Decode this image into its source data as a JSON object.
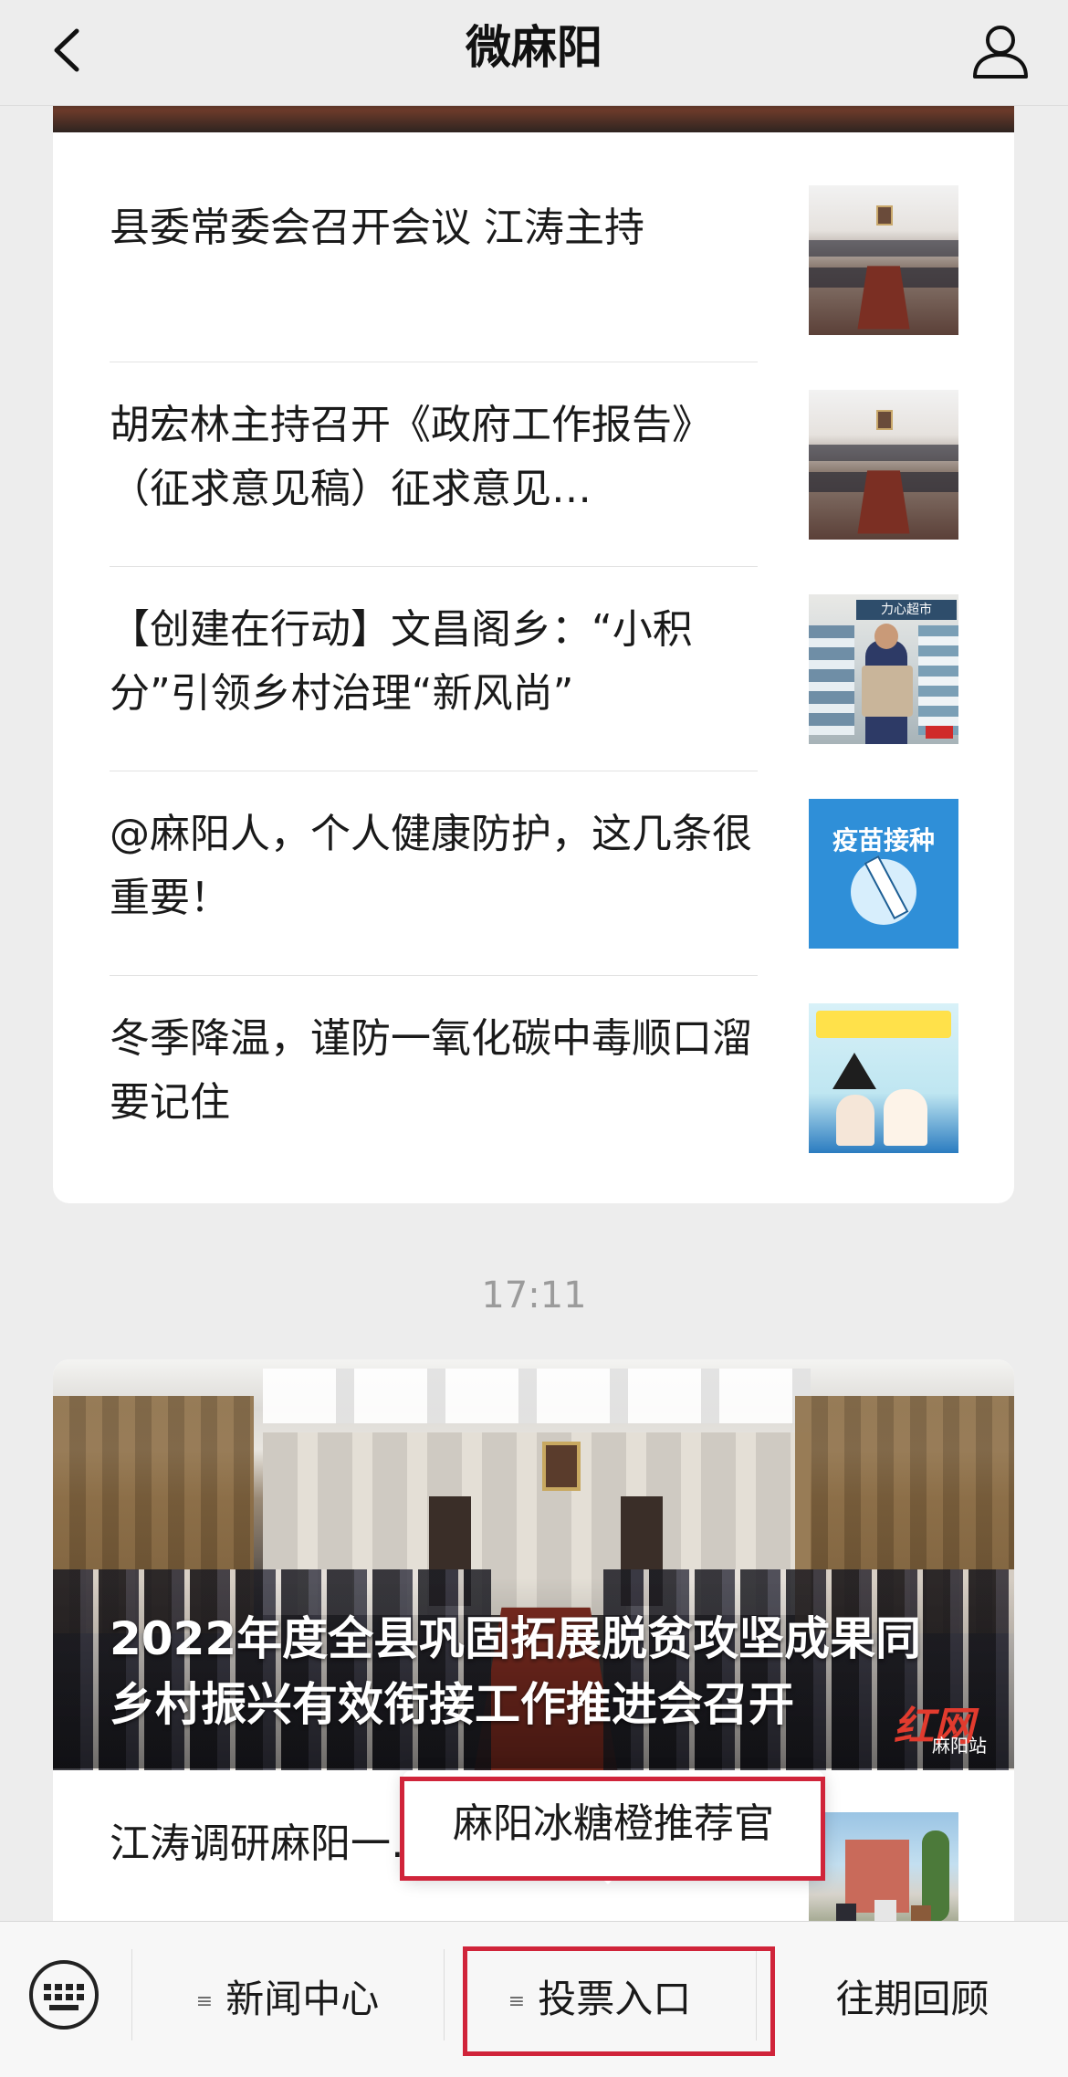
{
  "header": {
    "title": "微麻阳",
    "back_icon": "chevron-left-icon",
    "profile_icon": "user-icon"
  },
  "articles": [
    {
      "title": "县委常委会召开会议 江涛主持",
      "thumbnail": "meeting-photo"
    },
    {
      "title": "胡宏林主持召开《政府工作报告》（征求意见稿）征求意见…",
      "thumbnail": "meeting-photo"
    },
    {
      "title": "【创建在行动】文昌阁乡：“小积分”引领乡村治理“新风尚”",
      "thumbnail": "shop-photo",
      "thumbnail_sign": "力心超市"
    },
    {
      "title": "@麻阳人，个人健康防护，这几条很重要！",
      "thumbnail": "vaccine-poster",
      "thumbnail_text": "疫苗接种"
    },
    {
      "title": "冬季降温，谨防一氧化碳中毒顺口溜要记住",
      "thumbnail": "co-poster"
    }
  ],
  "timestamp": "17:11",
  "featured": {
    "title": "2022年度全县巩固拓展脱贫攻坚成果同乡村振兴有效衔接工作推进会召开",
    "watermark_main": "红网",
    "watermark_sub": "麻阳站",
    "sub_article_title": "江涛调研麻阳一…备工作"
  },
  "popup_menu": {
    "items": [
      "麻阳冰糖橙推荐官"
    ],
    "highlight_color": "#d0243a"
  },
  "bottom_menu": {
    "keyboard_icon": "keyboard-icon",
    "items": [
      {
        "label": "新闻中心",
        "has_submenu": true
      },
      {
        "label": "投票入口",
        "has_submenu": true
      },
      {
        "label": "往期回顾",
        "has_submenu": false
      }
    ],
    "submenu_glyph": "≡"
  },
  "colors": {
    "background": "#ededed",
    "card": "#ffffff",
    "timestamp": "#9b9b9b",
    "highlight": "#d0243a"
  }
}
